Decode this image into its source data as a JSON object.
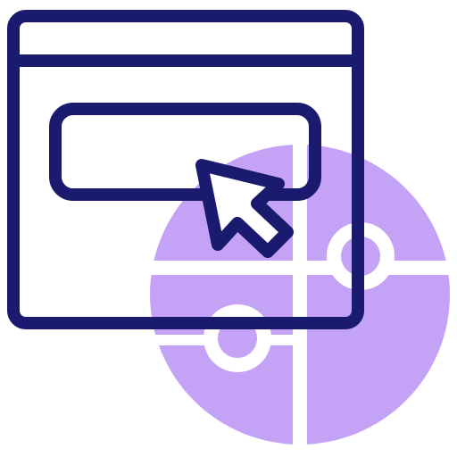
{
  "icon": {
    "name": "browser-click-puzzle-icon",
    "parts": [
      "browser-window-icon",
      "input-box",
      "mouse-cursor-icon",
      "puzzle-circle-icon"
    ]
  },
  "colors": {
    "outline": "#1a1a6e",
    "accent": "#c4a3f7",
    "gap": "#ffffff",
    "background": "#ffffff"
  }
}
